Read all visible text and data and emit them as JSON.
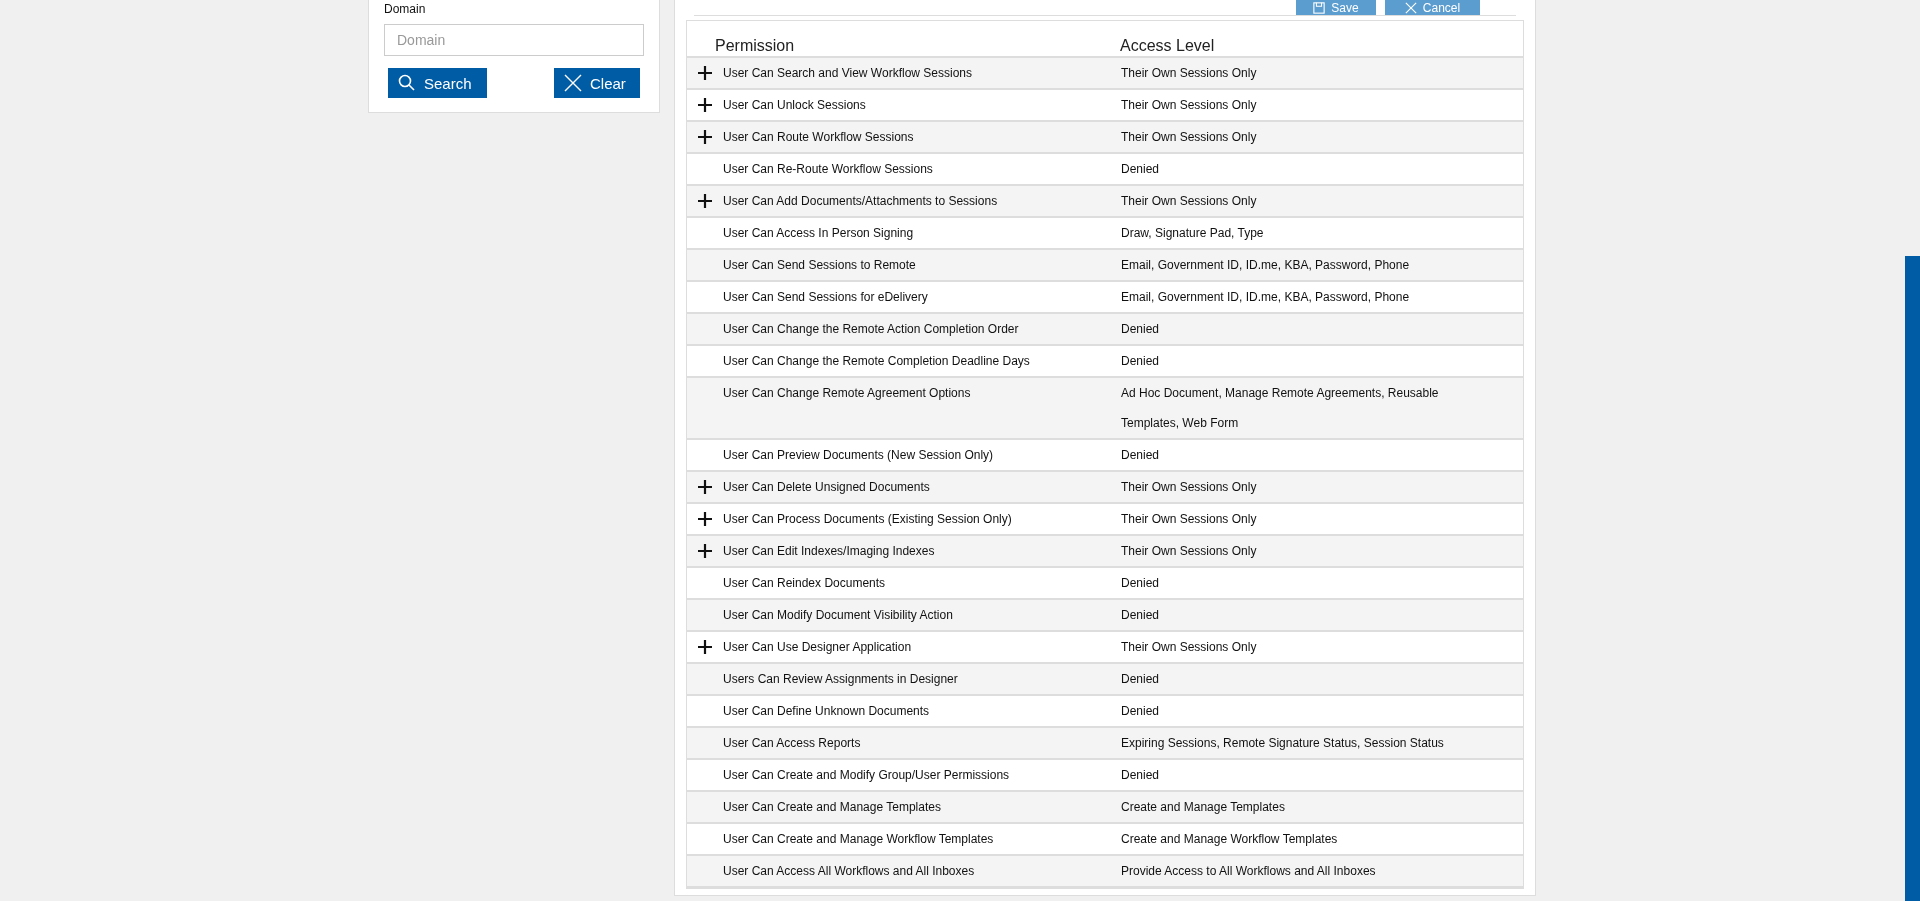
{
  "filter": {
    "label": "Domain",
    "placeholder": "Domain",
    "buttons": [
      {
        "kind": "search",
        "label": "Search"
      },
      {
        "kind": "clear",
        "label": "Clear"
      }
    ]
  },
  "actions": [
    {
      "kind": "save",
      "label": "Save"
    },
    {
      "kind": "cancel",
      "label": "Cancel"
    }
  ],
  "table": {
    "columns": [
      "Permission",
      "Access Level"
    ],
    "rows": [
      {
        "permission": "User Can Search and View Workflow Sessions",
        "access": "Their Own Sessions Only",
        "expandable": true
      },
      {
        "permission": "User Can Unlock Sessions",
        "access": "Their Own Sessions Only",
        "expandable": true
      },
      {
        "permission": "User Can Route Workflow Sessions",
        "access": "Their Own Sessions Only",
        "expandable": true
      },
      {
        "permission": "User Can Re-Route Workflow Sessions",
        "access": "Denied",
        "expandable": false
      },
      {
        "permission": "User Can Add Documents/Attachments to Sessions",
        "access": "Their Own Sessions Only",
        "expandable": true
      },
      {
        "permission": "User Can Access In Person Signing",
        "access": "Draw, Signature Pad, Type",
        "expandable": false
      },
      {
        "permission": "User Can Send Sessions to Remote",
        "access": "Email, Government ID, ID.me, KBA, Password, Phone",
        "expandable": false
      },
      {
        "permission": "User Can Send Sessions for eDelivery",
        "access": "Email, Government ID, ID.me, KBA, Password, Phone",
        "expandable": false
      },
      {
        "permission": "User Can Change the Remote Action Completion Order",
        "access": "Denied",
        "expandable": false
      },
      {
        "permission": "User Can Change the Remote Completion Deadline Days",
        "access": "Denied",
        "expandable": false
      },
      {
        "permission": "User Can Change Remote Agreement Options",
        "access": "Ad Hoc Document, Manage Remote Agreements, Reusable Templates, Web Form",
        "expandable": false
      },
      {
        "permission": "User Can Preview Documents (New Session Only)",
        "access": "Denied",
        "expandable": false
      },
      {
        "permission": "User Can Delete Unsigned Documents",
        "access": "Their Own Sessions Only",
        "expandable": true
      },
      {
        "permission": "User Can Process Documents (Existing Session Only)",
        "access": "Their Own Sessions Only",
        "expandable": true
      },
      {
        "permission": "User Can Edit Indexes/Imaging Indexes",
        "access": "Their Own Sessions Only",
        "expandable": true
      },
      {
        "permission": "User Can Reindex Documents",
        "access": "Denied",
        "expandable": false
      },
      {
        "permission": "User Can Modify Document Visibility Action",
        "access": "Denied",
        "expandable": false
      },
      {
        "permission": "User Can Use Designer Application",
        "access": "Their Own Sessions Only",
        "expandable": true
      },
      {
        "permission": "Users Can Review Assignments in Designer",
        "access": "Denied",
        "expandable": false
      },
      {
        "permission": "User Can Define Unknown Documents",
        "access": "Denied",
        "expandable": false
      },
      {
        "permission": "User Can Access Reports",
        "access": "Expiring Sessions, Remote Signature Status, Session Status",
        "expandable": false
      },
      {
        "permission": "User Can Create and Modify Group/User Permissions",
        "access": "Denied",
        "expandable": false
      },
      {
        "permission": "User Can Create and Manage Templates",
        "access": "Create and Manage Templates",
        "expandable": false
      },
      {
        "permission": "User Can Create and Manage Workflow Templates",
        "access": "Create and Manage Workflow Templates",
        "expandable": false
      },
      {
        "permission": "User Can Access All Workflows and All Inboxes",
        "access": "Provide Access to All Workflows and All Inboxes",
        "expandable": false
      }
    ]
  }
}
